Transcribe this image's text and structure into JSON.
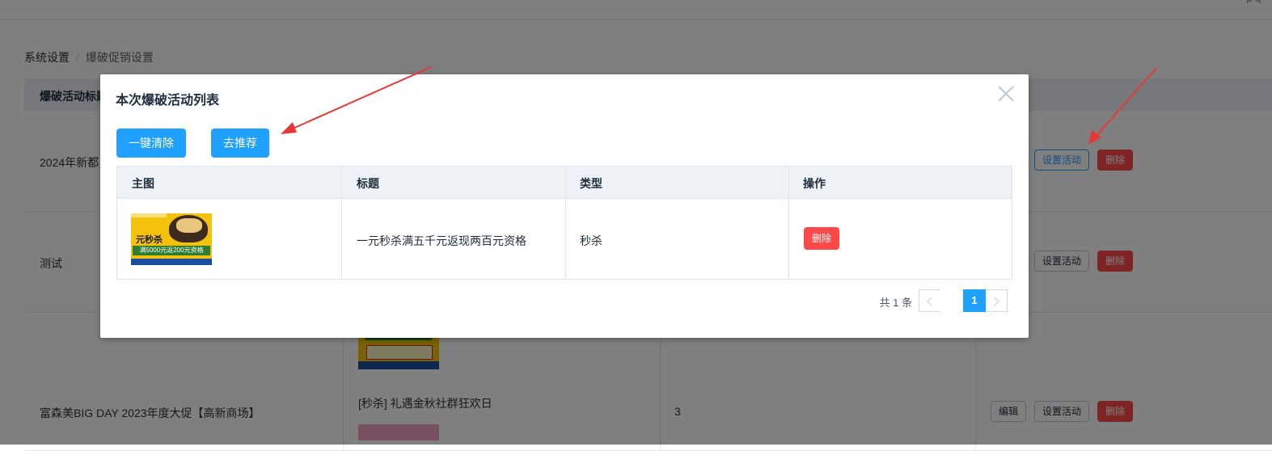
{
  "breadcrumb": {
    "root": "系统设置",
    "separator": "/",
    "current": "爆破促销设置"
  },
  "background_table": {
    "header_first_col": "爆破活动标题",
    "rows": [
      {
        "title": "2024年新都",
        "actions": [
          "设置活动",
          "删除"
        ]
      },
      {
        "title": "测试",
        "actions": [
          "设置活动",
          "删除"
        ]
      },
      {
        "title": "富森美BIG DAY 2023年度大促【高新商场】",
        "product": "[秒杀] 礼遇金秋社群狂欢日",
        "count": "3",
        "actions": [
          "编辑",
          "设置活动",
          "删除"
        ]
      }
    ]
  },
  "dialog": {
    "title": "本次爆破活动列表",
    "buttons": {
      "clear_all": "一键清除",
      "recommend": "去推荐"
    },
    "columns": [
      "主图",
      "标题",
      "类型",
      "操作"
    ],
    "rows": [
      {
        "image_title": "元秒杀",
        "image_band": "满5000元返200元资格",
        "title": "一元秒杀满五千元返现两百元资格",
        "type": "秒杀",
        "action": "删除"
      }
    ],
    "pagination": {
      "total_text": "共 1 条",
      "current_page": "1"
    }
  },
  "colors": {
    "primary": "#20a0ff",
    "danger": "#ff4949",
    "annotation_arrow": "#e53935"
  }
}
